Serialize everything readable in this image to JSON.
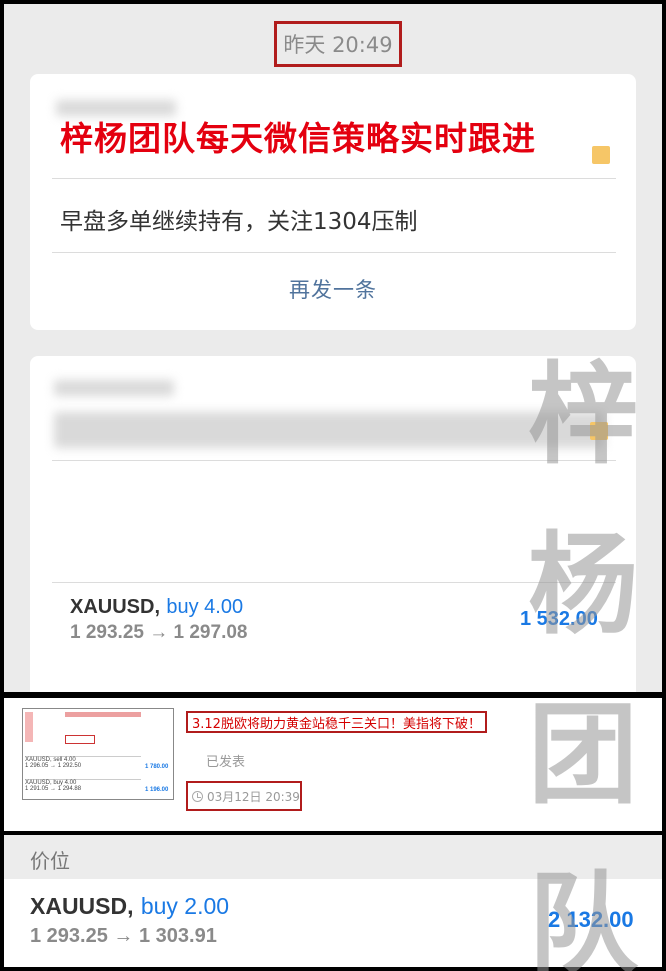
{
  "chat": {
    "timestamp": "昨天 20:49",
    "strategy_card": {
      "headline": "梓杨团队每天微信策略实时跟进",
      "message": "早盘多单继续持有，关注1304压制",
      "resend_label": "再发一条"
    },
    "trade_card": {
      "symbol": "XAUUSD,",
      "side": "buy 4.00",
      "prices": "1 293.25 → 1 297.08",
      "profit": "1 532.00"
    }
  },
  "article": {
    "title": "3.12脱欧将助力黄金站稳千三关口！美指将下破！",
    "status": "已发表",
    "time": "03月12日 20:39",
    "thumbnail": {
      "row1": {
        "symbol": "XAUUSD, sell 4.00",
        "prices": "1 296.05 → 1 292.50",
        "profit": "1 780.00"
      },
      "row2": {
        "symbol": "XAUUSD, buy 4.00",
        "prices": "1 291.05 → 1 294.88",
        "profit": "1 196.00"
      }
    }
  },
  "positions": {
    "header": "价位",
    "row": {
      "symbol": "XAUUSD,",
      "side": "buy 2.00",
      "prices": "1 293.25 → 1 303.91",
      "profit": "2 132.00"
    }
  },
  "watermark": [
    "梓",
    "杨",
    "团",
    "队"
  ],
  "colors": {
    "headline_red": "#e4000f",
    "highlight_box": "#b11c1c",
    "buy_blue": "#1a79e4",
    "link_blue": "#50739c"
  }
}
